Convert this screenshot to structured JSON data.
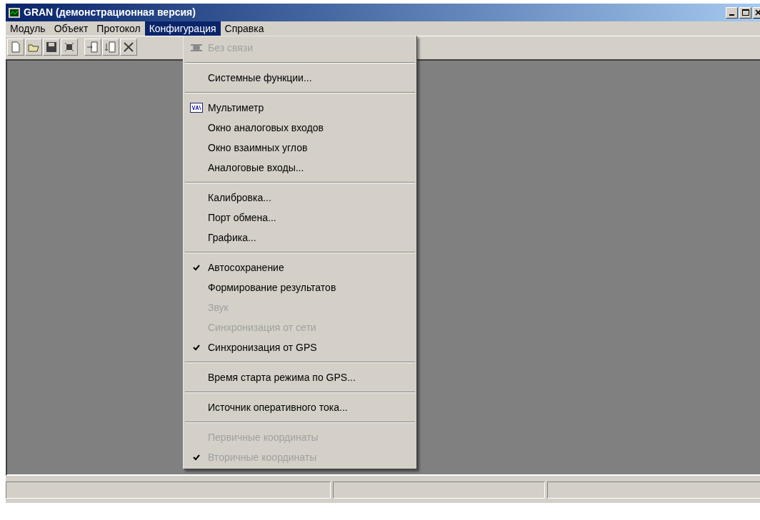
{
  "window": {
    "title": "GRAN (демонстрационная версия)"
  },
  "menu_bar": [
    {
      "label": "Модуль",
      "selected": false
    },
    {
      "label": "Объект",
      "selected": false
    },
    {
      "label": "Протокол",
      "selected": false
    },
    {
      "label": "Конфигурация",
      "selected": true
    },
    {
      "label": "Справка",
      "selected": false
    }
  ],
  "toolbar": [
    {
      "kind": "new"
    },
    {
      "kind": "open"
    },
    {
      "kind": "save"
    },
    {
      "kind": "chip"
    },
    {
      "kind": "gap"
    },
    {
      "kind": "import"
    },
    {
      "kind": "export"
    },
    {
      "kind": "cut"
    }
  ],
  "dropdown": [
    {
      "kind": "item",
      "label": "Без связи",
      "checked": false,
      "disabled": true
    },
    {
      "kind": "separator"
    },
    {
      "kind": "item",
      "label": "Системные функции...",
      "checked": false,
      "disabled": false
    },
    {
      "kind": "separator"
    },
    {
      "kind": "item",
      "label": "Мультиметр",
      "checked": false,
      "disabled": false
    },
    {
      "kind": "item",
      "label": "Окно аналоговых входов",
      "checked": false,
      "disabled": false
    },
    {
      "kind": "item",
      "label": "Окно взаимных углов",
      "checked": false,
      "disabled": false
    },
    {
      "kind": "item",
      "label": "Аналоговые входы...",
      "checked": false,
      "disabled": false
    },
    {
      "kind": "separator"
    },
    {
      "kind": "item",
      "label": "Калибровка...",
      "checked": false,
      "disabled": false
    },
    {
      "kind": "item",
      "label": "Порт обмена...",
      "checked": false,
      "disabled": false
    },
    {
      "kind": "item",
      "label": "Графика...",
      "checked": false,
      "disabled": false
    },
    {
      "kind": "separator"
    },
    {
      "kind": "item",
      "label": "Автосохранение",
      "checked": true,
      "disabled": false
    },
    {
      "kind": "item",
      "label": "Формирование результатов",
      "checked": false,
      "disabled": false
    },
    {
      "kind": "item",
      "label": "Звук",
      "checked": false,
      "disabled": true
    },
    {
      "kind": "item",
      "label": "Синхронизация от сети",
      "checked": false,
      "disabled": true
    },
    {
      "kind": "item",
      "label": "Синхронизация от GPS",
      "checked": true,
      "disabled": false
    },
    {
      "kind": "separator"
    },
    {
      "kind": "item",
      "label": "Время старта режима по GPS...",
      "checked": false,
      "disabled": false
    },
    {
      "kind": "separator"
    },
    {
      "kind": "item",
      "label": "Источник оперативного тока...",
      "checked": false,
      "disabled": false
    },
    {
      "kind": "separator"
    },
    {
      "kind": "item",
      "label": "Первичные координаты",
      "checked": false,
      "disabled": true
    },
    {
      "kind": "item",
      "label": "Вторичные координаты",
      "checked": true,
      "disabled": true
    }
  ]
}
